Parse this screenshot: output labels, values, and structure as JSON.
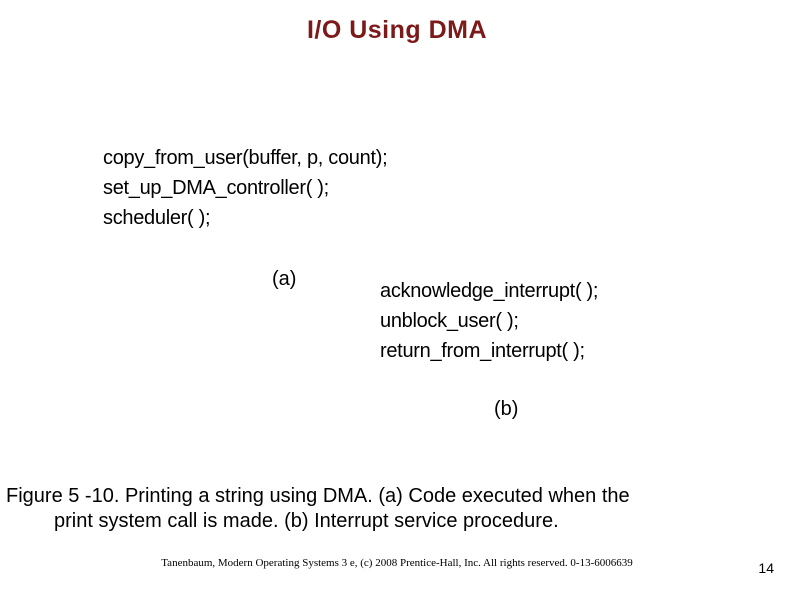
{
  "title": "I/O Using DMA",
  "code_a": {
    "line1": "copy_from_user(buffer, p, count);",
    "line2": "set_up_DMA_controller( );",
    "line3": "scheduler( );"
  },
  "label_a": "(a)",
  "code_b": {
    "line1": "acknowledge_interrupt( );",
    "line2": "unblock_user( );",
    "line3": "return_from_interrupt( );"
  },
  "label_b": "(b)",
  "caption": {
    "line1": "Figure 5 -10. Printing a string using DMA. (a) Code executed when the",
    "line2": "print system call is made. (b) Interrupt service procedure."
  },
  "citation": "Tanenbaum, Modern Operating Systems 3 e, (c) 2008 Prentice-Hall, Inc. All rights reserved. 0-13-6006639",
  "page_num": "14"
}
